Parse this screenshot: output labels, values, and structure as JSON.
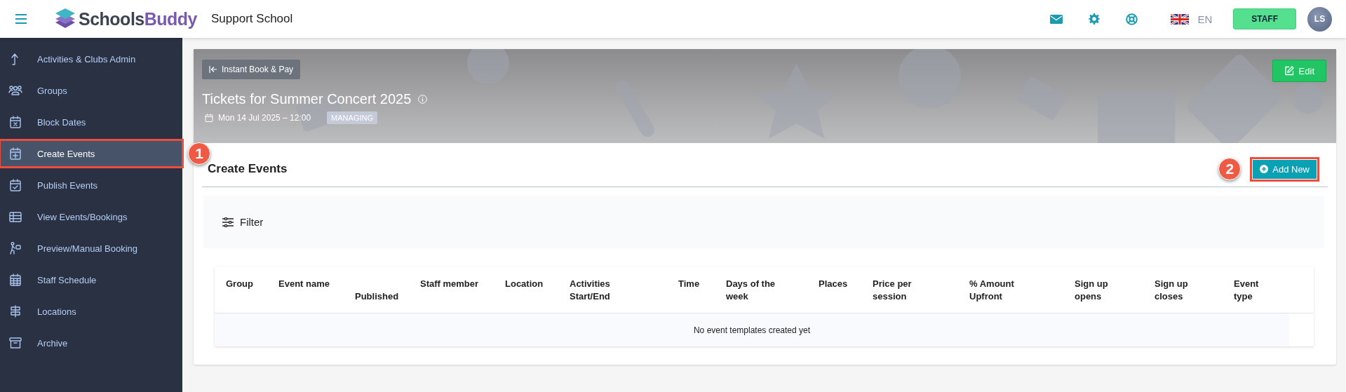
{
  "topbar": {
    "brand": {
      "first": "Schools",
      "second": "Buddy"
    },
    "school": "Support School",
    "language": "EN",
    "role_button": "STAFF",
    "avatar": "LS"
  },
  "sidebar": {
    "items": [
      {
        "label": "Activities & Clubs Admin",
        "selected": false
      },
      {
        "label": "Groups",
        "selected": false
      },
      {
        "label": "Block Dates",
        "selected": false
      },
      {
        "label": "Create Events",
        "selected": true,
        "callout": "1"
      },
      {
        "label": "Publish Events",
        "selected": false
      },
      {
        "label": "View Events/Bookings",
        "selected": false
      },
      {
        "label": "Preview/Manual Booking",
        "selected": false
      },
      {
        "label": "Staff Schedule",
        "selected": false
      },
      {
        "label": "Locations",
        "selected": false
      },
      {
        "label": "Archive",
        "selected": false
      }
    ]
  },
  "banner": {
    "back_button": "Instant Book & Pay",
    "edit_button": "Edit",
    "title": "Tickets for Summer Concert 2025",
    "date": "Mon 14 Jul 2025 – 12:00",
    "badge": "MANAGING"
  },
  "section": {
    "title": "Create Events",
    "add_button": {
      "label": "Add New",
      "callout": "2"
    }
  },
  "filter": {
    "label": "Filter"
  },
  "table": {
    "columns": [
      {
        "label": "Group"
      },
      {
        "label": "Event name"
      },
      {
        "label": "Published"
      },
      {
        "label": "Staff member"
      },
      {
        "label": "Location"
      },
      {
        "label": "Activities Start/End"
      },
      {
        "label": "Time"
      },
      {
        "label": "Days of the week"
      },
      {
        "label": "Places"
      },
      {
        "label": "Price per session"
      },
      {
        "label": "% Amount Upfront"
      },
      {
        "label": "Sign up opens"
      },
      {
        "label": "Sign up closes"
      },
      {
        "label": "Event type"
      }
    ],
    "empty_message": "No event templates created yet"
  }
}
